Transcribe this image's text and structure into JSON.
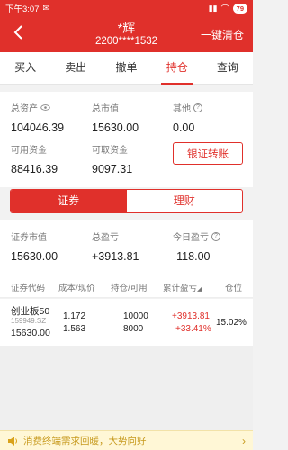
{
  "status_bar": {
    "time": "下午3:07",
    "battery": "79"
  },
  "header": {
    "name": "*辉",
    "account": "2200****1532",
    "right_action": "一键清仓"
  },
  "tabs": [
    {
      "label": "买入"
    },
    {
      "label": "卖出"
    },
    {
      "label": "撤单"
    },
    {
      "label": "持仓"
    },
    {
      "label": "查询"
    }
  ],
  "active_tab": "持仓",
  "assets": {
    "total_assets_label": "总资产",
    "total_assets": "104046.39",
    "market_value_label": "总市值",
    "market_value": "15630.00",
    "other_label": "其他",
    "other": "0.00",
    "available_label": "可用资金",
    "available": "88416.39",
    "withdrawable_label": "可取资金",
    "withdrawable": "9097.31",
    "transfer_button": "银证转账"
  },
  "sub_tabs": [
    {
      "label": "证券"
    },
    {
      "label": "理财"
    }
  ],
  "summary": {
    "sec_value_label": "证券市值",
    "sec_value": "15630.00",
    "total_pl_label": "总盈亏",
    "total_pl": "+3913.81",
    "today_pl_label": "今日盈亏",
    "today_pl": "-118.00"
  },
  "table": {
    "headers": [
      "证券代码",
      "成本/现价",
      "持仓/可用",
      "累计盈亏",
      "仓位"
    ],
    "rows": [
      {
        "name": "创业板50",
        "code": "159949.SZ",
        "value": "15630.00",
        "cost": "1.172",
        "price": "1.563",
        "hold": "10000",
        "available": "8000",
        "pl": "+3913.81",
        "pl_pct": "+33.41%",
        "position": "15.02%"
      }
    ]
  },
  "banner": {
    "text": "消费终端需求回暖，大势向好"
  },
  "colors": {
    "brand_red": "#e0302b",
    "gain": "#e0302b",
    "loss": "#1a9c3a",
    "banner_text": "#c79a1e"
  }
}
